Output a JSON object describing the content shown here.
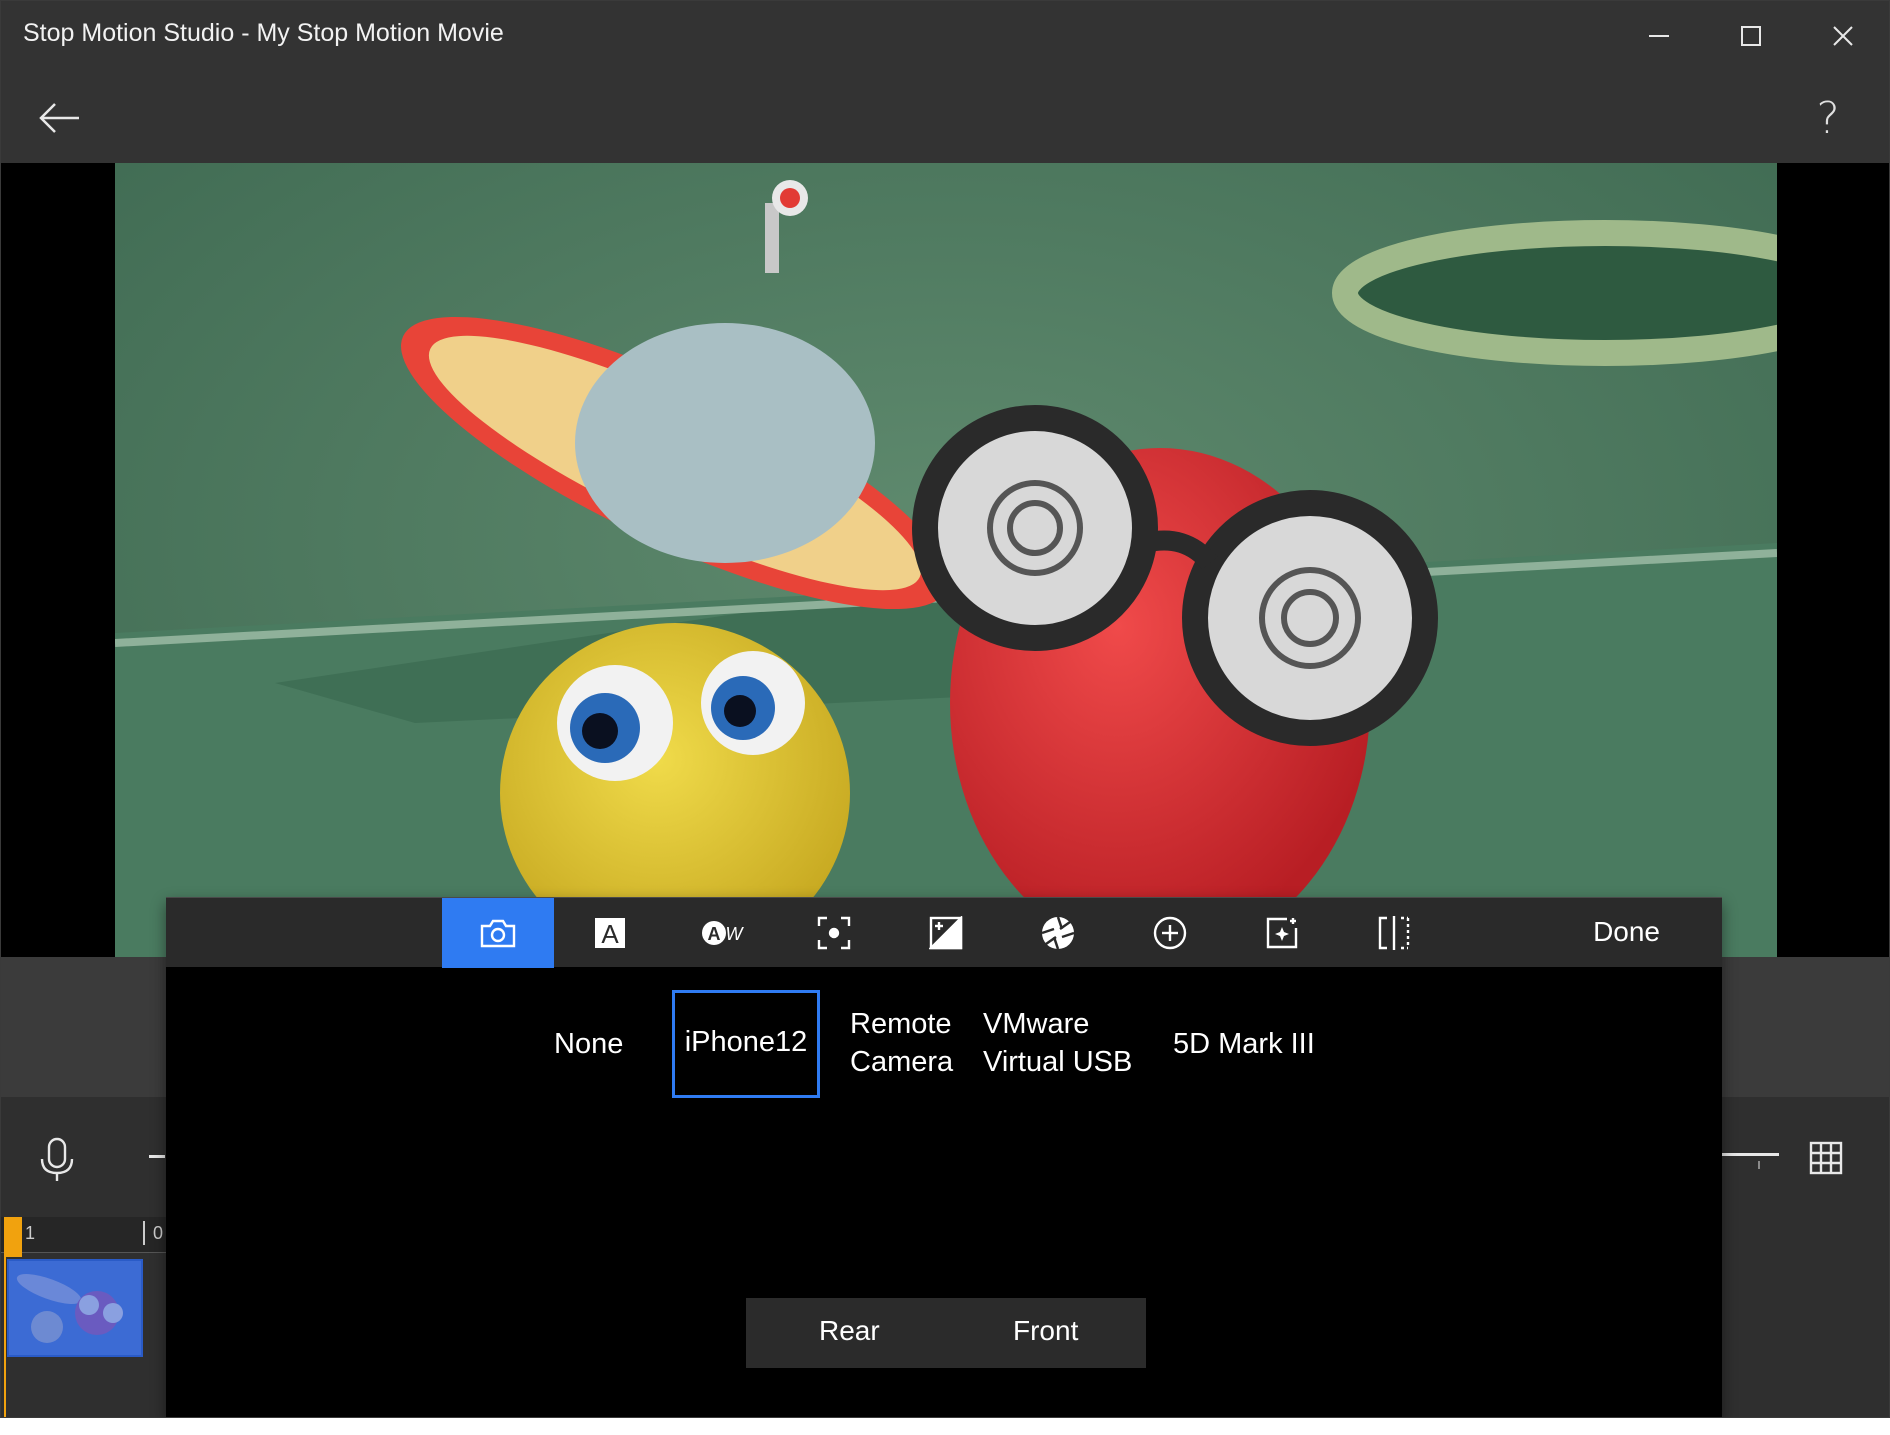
{
  "window": {
    "title": "Stop Motion Studio - My Stop Motion Movie"
  },
  "appbar": {
    "back_icon": "back-arrow-icon",
    "help_label": "?"
  },
  "toolbar": {
    "tools": [
      {
        "name": "camera-icon",
        "active": true
      },
      {
        "name": "auto-focus-icon",
        "active": false
      },
      {
        "name": "auto-white-balance-icon",
        "active": false
      },
      {
        "name": "focus-point-icon",
        "active": false
      },
      {
        "name": "exposure-icon",
        "active": false
      },
      {
        "name": "aperture-icon",
        "active": false
      },
      {
        "name": "zoom-icon",
        "active": false
      },
      {
        "name": "effects-icon",
        "active": false
      },
      {
        "name": "mirror-icon",
        "active": false
      }
    ],
    "done_label": "Done"
  },
  "devices": {
    "none": "None",
    "iphone": "iPhone12",
    "remote_line1": "Remote",
    "remote_line2": "Camera",
    "vmware_line1": "VMware",
    "vmware_line2": "Virtual USB",
    "canon": "5D Mark III",
    "selected": "iPhone12"
  },
  "camera_switch": {
    "rear": "Rear",
    "front": "Front"
  },
  "timeline": {
    "frame_label_1": "1",
    "frame_label_2": "0"
  },
  "colors": {
    "accent": "#2f7bf2",
    "playhead": "#f1a20e"
  }
}
